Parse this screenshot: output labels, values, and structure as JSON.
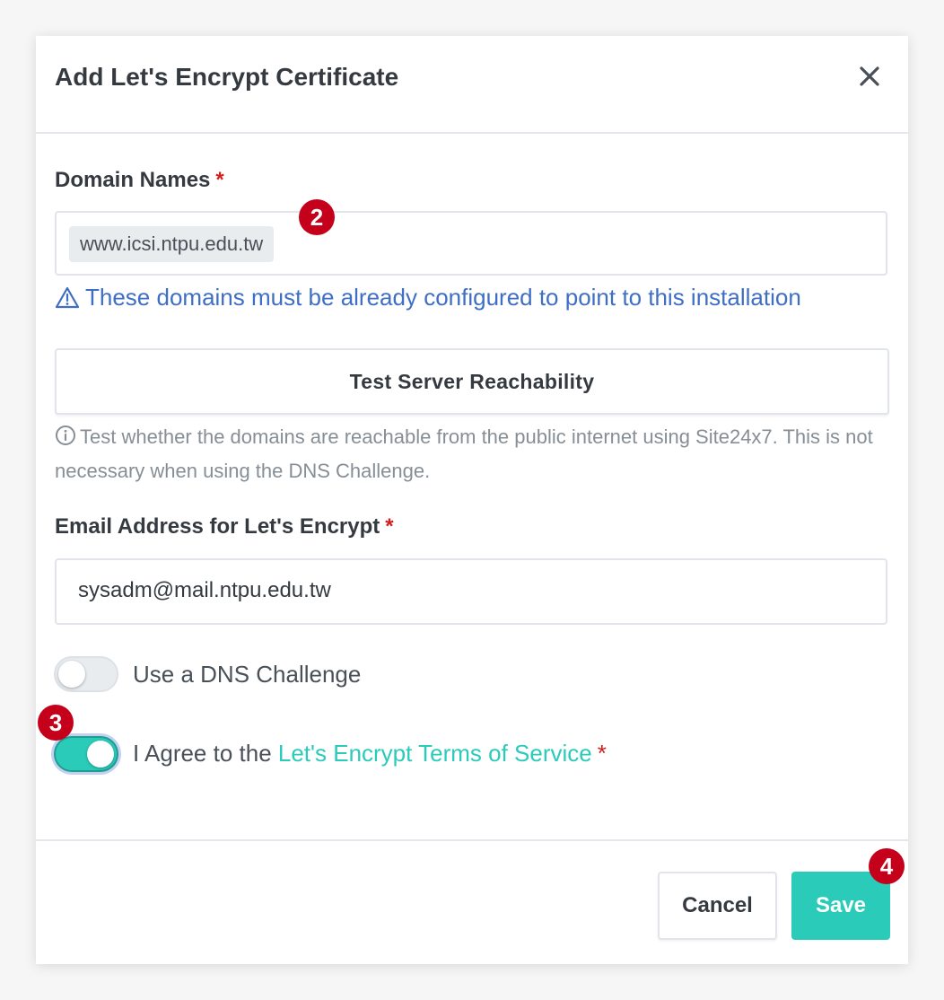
{
  "modal": {
    "title": "Add Let's Encrypt Certificate",
    "close_icon": "close-icon"
  },
  "domain_names": {
    "label": "Domain Names",
    "required_marker": "*",
    "chips": [
      "www.icsi.ntpu.edu.tw"
    ],
    "warning_icon": "warning-triangle-icon",
    "warning": "These domains must be already configured to point to this installation"
  },
  "test_reachability": {
    "button_label": "Test Server Reachability",
    "info_icon": "info-circle-icon",
    "info": "Test whether the domains are reachable from the public internet using Site24x7. This is not necessary when using the DNS Challenge."
  },
  "email": {
    "label": "Email Address for Let's Encrypt",
    "required_marker": "*",
    "value": "sysadm@mail.ntpu.edu.tw"
  },
  "dns_challenge": {
    "label": "Use a DNS Challenge",
    "enabled": false
  },
  "agree_tos": {
    "label_prefix": "I Agree to the ",
    "link_text": "Let's Encrypt Terms of Service",
    "required_marker": "*",
    "enabled": true
  },
  "footer": {
    "cancel_label": "Cancel",
    "save_label": "Save"
  },
  "annotations": {
    "badge_domain": "2",
    "badge_agree": "3",
    "badge_save": "4"
  },
  "colors": {
    "accent": "#2bcbba",
    "link_blue": "#3f6fc4",
    "required_red": "#cd201f",
    "badge_red": "#c4001a"
  }
}
